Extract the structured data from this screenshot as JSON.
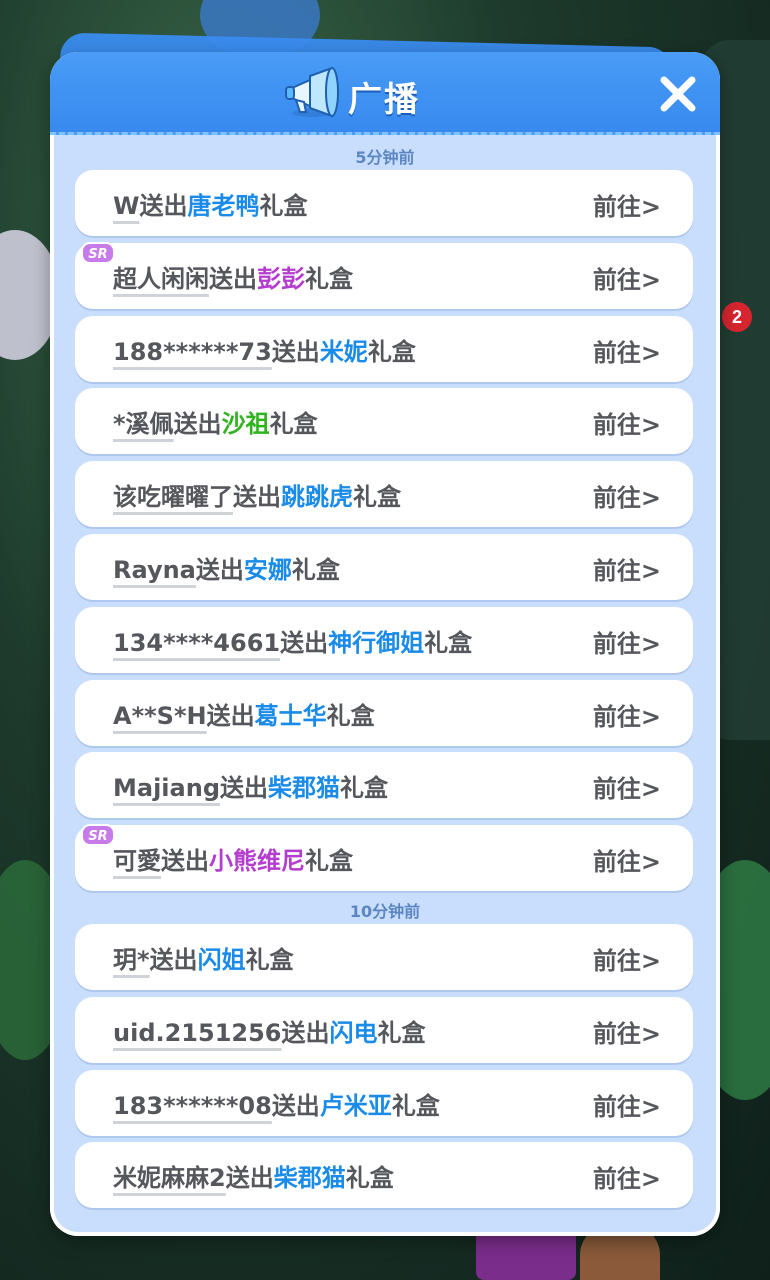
{
  "dialog": {
    "title": "广播",
    "close_label": "✕"
  },
  "background": {
    "notification_count": "2"
  },
  "colors": {
    "header": "#3789ee",
    "blue_gift": "#1a8be8",
    "purple_gift": "#b43dcf",
    "green_gift": "#2fb31e",
    "sr_badge": "#c77be8"
  },
  "groups": [
    {
      "time_label": "5分钟前",
      "items": [
        {
          "user": "W",
          "action": "送出",
          "gift": "唐老鸭",
          "suffix": "礼盒",
          "go": "前往>",
          "gift_color": "blue",
          "sr": false
        },
        {
          "user": "超人闲闲",
          "action": "送出",
          "gift": "彭彭",
          "suffix": "礼盒",
          "go": "前往>",
          "gift_color": "purple",
          "sr": true
        },
        {
          "user": "188******73",
          "action": "送出",
          "gift": "米妮",
          "suffix": "礼盒",
          "go": "前往>",
          "gift_color": "blue",
          "sr": false
        },
        {
          "user": "*溪佩",
          "action": "送出",
          "gift": "沙祖",
          "suffix": "礼盒",
          "go": "前往>",
          "gift_color": "green",
          "sr": false
        },
        {
          "user": "该吃曜曜了",
          "action": "送出",
          "gift": "跳跳虎",
          "suffix": "礼盒",
          "go": "前往>",
          "gift_color": "blue",
          "sr": false
        },
        {
          "user": "Rayna",
          "action": "送出",
          "gift": "安娜",
          "suffix": "礼盒",
          "go": "前往>",
          "gift_color": "blue",
          "sr": false
        },
        {
          "user": "134****4661",
          "action": "送出",
          "gift": "神行御姐",
          "suffix": "礼盒",
          "go": "前往>",
          "gift_color": "blue",
          "sr": false
        },
        {
          "user": "A**S*H",
          "action": "送出",
          "gift": "葛士华",
          "suffix": "礼盒",
          "go": "前往>",
          "gift_color": "blue",
          "sr": false
        },
        {
          "user": "Majiang",
          "action": "送出",
          "gift": "柴郡猫",
          "suffix": "礼盒",
          "go": "前往>",
          "gift_color": "blue",
          "sr": false
        },
        {
          "user": "可愛",
          "action": "送出",
          "gift": "小熊维尼",
          "suffix": "礼盒",
          "go": "前往>",
          "gift_color": "purple",
          "sr": true
        }
      ]
    },
    {
      "time_label": "10分钟前",
      "items": [
        {
          "user": "玥*",
          "action": "送出",
          "gift": "闪姐",
          "suffix": "礼盒",
          "go": "前往>",
          "gift_color": "blue",
          "sr": false
        },
        {
          "user": "uid.2151256",
          "action": "送出",
          "gift": "闪电",
          "suffix": "礼盒",
          "go": "前往>",
          "gift_color": "blue",
          "sr": false
        },
        {
          "user": "183******08",
          "action": "送出",
          "gift": "卢米亚",
          "suffix": "礼盒",
          "go": "前往>",
          "gift_color": "blue",
          "sr": false
        },
        {
          "user": "米妮麻麻2",
          "action": "送出",
          "gift": "柴郡猫",
          "suffix": "礼盒",
          "go": "前往>",
          "gift_color": "blue",
          "sr": false
        }
      ]
    }
  ],
  "sr_badge_text": "SR"
}
